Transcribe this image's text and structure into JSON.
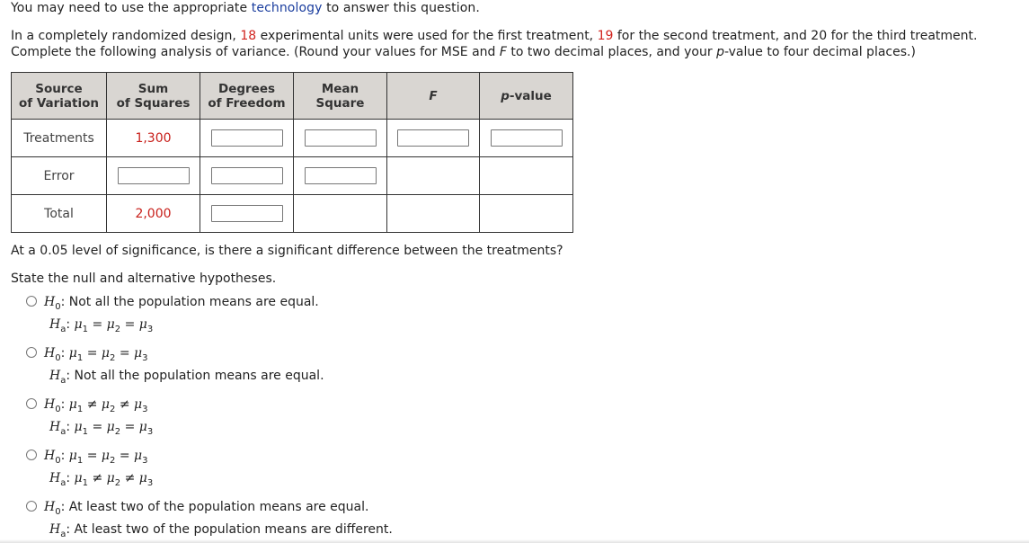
{
  "intro": {
    "prefix": "You may need to use the appropriate ",
    "link": "technology",
    "suffix": " to answer this question."
  },
  "question": {
    "p1": "In a completely randomized design, ",
    "n1": "18",
    "p2": " experimental units were used for the first treatment, ",
    "n2": "19",
    "p3": " for the second treatment, and 20 for the third treatment. Complete the following analysis of variance. (Round your values for MSE and ",
    "F": "F",
    "p4": " to two decimal places, and your ",
    "p": "p",
    "p5": "-value to four decimal places.)"
  },
  "table": {
    "headers": {
      "source_1": "Source",
      "source_2": "of Variation",
      "ss_1": "Sum",
      "ss_2": "of Squares",
      "df_1": "Degrees",
      "df_2": "of Freedom",
      "ms_1": "Mean",
      "ms_2": "Square",
      "f": "F",
      "p": "p",
      "p_suffix": "-value"
    },
    "rows": {
      "treatments": {
        "label": "Treatments",
        "ss": "1,300"
      },
      "error": {
        "label": "Error"
      },
      "total": {
        "label": "Total",
        "ss": "2,000"
      }
    },
    "inputs": {
      "treatments_df": "",
      "treatments_ms": "",
      "treatments_f": "",
      "treatments_p": "",
      "error_ss": "",
      "error_df": "",
      "error_ms": "",
      "total_df": ""
    }
  },
  "significance_question": "At a 0.05 level of significance, is there a significant difference between the treatments?",
  "state_prompt": "State the null and alternative hypotheses.",
  "options": [
    {
      "h0": "Not all the population means are equal.",
      "ha": "μ1 = μ2 = μ3"
    },
    {
      "h0": "μ1 = μ2 = μ3",
      "ha": "Not all the population means are equal."
    },
    {
      "h0": "μ1 ≠ μ2 ≠ μ3",
      "ha": "μ1 = μ2 = μ3"
    },
    {
      "h0": "μ1 = μ2 = μ3",
      "ha": "μ1 ≠ μ2 ≠ μ3"
    },
    {
      "h0": "At least two of the population means are equal.",
      "ha": "At least two of the population means are different."
    }
  ],
  "hyp_labels": {
    "H": "H",
    "null_sub": "0",
    "alt_sub": "a",
    "colon": ":"
  },
  "math": {
    "mu": "μ",
    "eq": "=",
    "neq": "≠",
    "s1": "1",
    "s2": "2",
    "s3": "3"
  }
}
